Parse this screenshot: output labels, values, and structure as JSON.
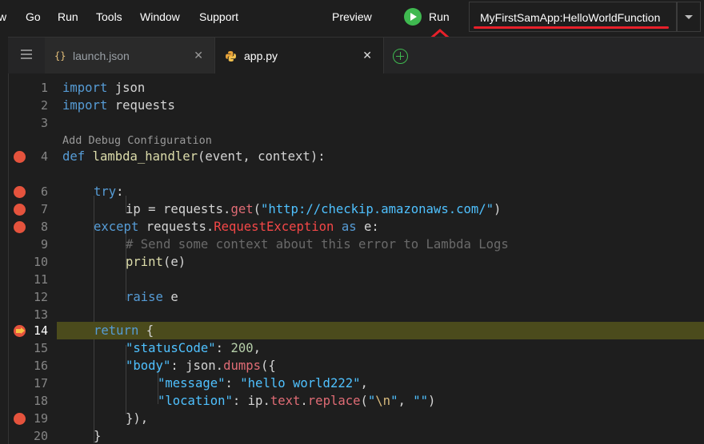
{
  "menu": {
    "partial": "w",
    "go": "Go",
    "run": "Run",
    "tools": "Tools",
    "window": "Window",
    "support": "Support",
    "preview": "Preview"
  },
  "toolbar": {
    "run_label": "Run",
    "config_label": "MyFirstSamApp:HelloWorldFunction"
  },
  "tabs": [
    {
      "label": "launch.json",
      "icon": "{}",
      "active": false
    },
    {
      "label": "app.py",
      "icon": "python-icon",
      "active": true
    }
  ],
  "editor": {
    "codelens": "Add Debug Configuration",
    "line_numbers": [
      "1",
      "2",
      "3",
      "4",
      "6",
      "7",
      "8",
      "9",
      "10",
      "11",
      "12",
      "13",
      "14",
      "15",
      "16",
      "17",
      "18",
      "19",
      "20"
    ],
    "current_line": "14",
    "breakpoint_lines": [
      "4",
      "6",
      "7",
      "8",
      "14",
      "19"
    ],
    "t_import": "import",
    "t_json": " json",
    "t_requests_mod": " requests",
    "t_def": "def",
    "t_handler": " lambda_handler",
    "t_handler_args": "(event, context):",
    "t_try": "try",
    "t_colon": ":",
    "t_ip_assign": "ip = requests.",
    "t_get": "get",
    "t_paren_open": "(",
    "t_url": "\"http://checkip.amazonaws.com/\"",
    "t_paren_close": ")",
    "t_except": "except",
    "t_requests_dot": " requests.",
    "t_request_exception": "RequestException",
    "t_as": " as",
    "t_e_colon": " e:",
    "t_comment": "# Send some context about this error to Lambda Logs",
    "t_print": "print",
    "t_print_args": "(e)",
    "t_raise": "raise",
    "t_e": " e",
    "t_return": "return",
    "t_brace_open": " {",
    "t_status_key": "\"statusCode\"",
    "t_status_sep": ": ",
    "t_status_val": "200",
    "t_comma": ",",
    "t_body_key": "\"body\"",
    "t_body_mid": ": json.",
    "t_dumps": "dumps",
    "t_dumps_open": "({",
    "t_message_key": "\"message\"",
    "t_message_sep": ": ",
    "t_message_val": "\"hello world222\"",
    "t_location_key": "\"location\"",
    "t_location_mid": ": ip.",
    "t_text": "text",
    "t_dot": ".",
    "t_replace": "replace",
    "t_quote_open": "\"",
    "t_newline_esc": "\\n",
    "t_quote_close": "\"",
    "t_sep_empty": ", ",
    "t_empty_str": "\"\"",
    "t_close_dumps": "}),",
    "t_final_brace": "}"
  },
  "colors": {
    "run_green": "#3fb950",
    "annotation_red": "#e8202a",
    "current_line_highlight": "#4b4b1c",
    "breakpoint": "#e5533d"
  }
}
